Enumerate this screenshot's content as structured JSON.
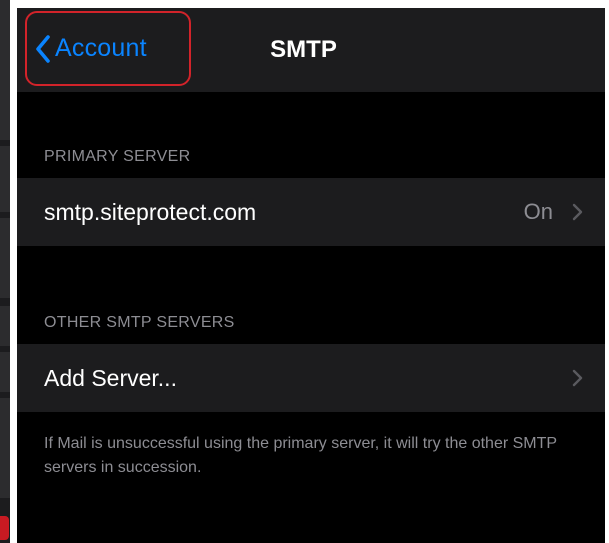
{
  "nav": {
    "back_label": "Account",
    "title": "SMTP"
  },
  "primary": {
    "header": "PRIMARY SERVER",
    "server_name": "smtp.siteprotect.com",
    "server_status": "On"
  },
  "other": {
    "header": "OTHER SMTP SERVERS",
    "add_label": "Add Server..."
  },
  "footer": {
    "note": "If Mail is unsuccessful using the primary server, it will try the other SMTP servers in succession."
  },
  "colors": {
    "accent": "#0a84ff",
    "highlight": "#d2232a",
    "cell_background": "#1c1c1e",
    "secondary_text": "#8d8d93"
  },
  "icons": {
    "back": "chevron-left-icon",
    "disclosure": "chevron-right-icon"
  }
}
